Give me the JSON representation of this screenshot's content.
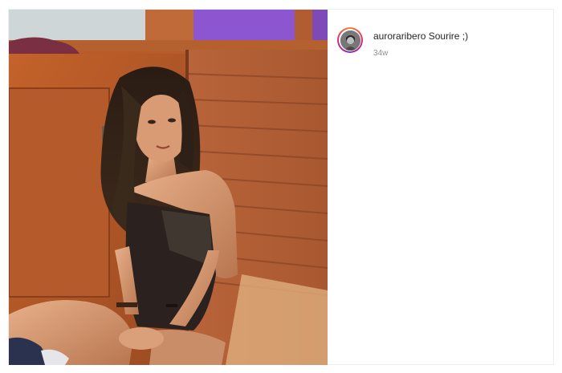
{
  "post": {
    "photo_alt": "",
    "caption": {
      "username": "auroraribero",
      "text": "Sourire ;)",
      "time": "34w"
    }
  }
}
